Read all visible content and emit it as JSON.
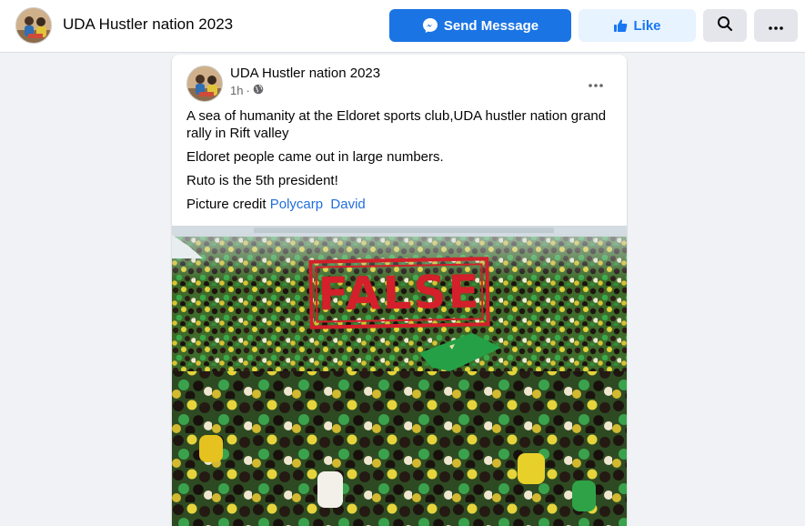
{
  "header": {
    "page_name": "UDA Hustler nation 2023",
    "send_message_label": "Send Message",
    "like_label": "Like",
    "icons": {
      "messenger": "messenger-icon",
      "like": "thumbs-up-icon",
      "search": "search-icon",
      "more": "more-horizontal-icon"
    }
  },
  "post": {
    "author": "UDA Hustler nation 2023",
    "time": "1h",
    "audience_icon": "globe-icon",
    "paragraphs": [
      "A sea of humanity at the Eldoret sports club,UDA hustler nation grand rally in Rift valley",
      "Eldoret people came out in large numbers.",
      "Ruto is the 5th president!"
    ],
    "credit_prefix": "Picture credit",
    "credit_first": "Polycarp",
    "credit_last": "David",
    "image": {
      "description": "crowd-photo",
      "stamp_text": "FALSE",
      "stamp_color": "#d3202a"
    }
  },
  "colors": {
    "accent": "#1b74e4",
    "like_bg": "#e7f3ff",
    "link": "#216fdb",
    "muted": "#65676b"
  }
}
